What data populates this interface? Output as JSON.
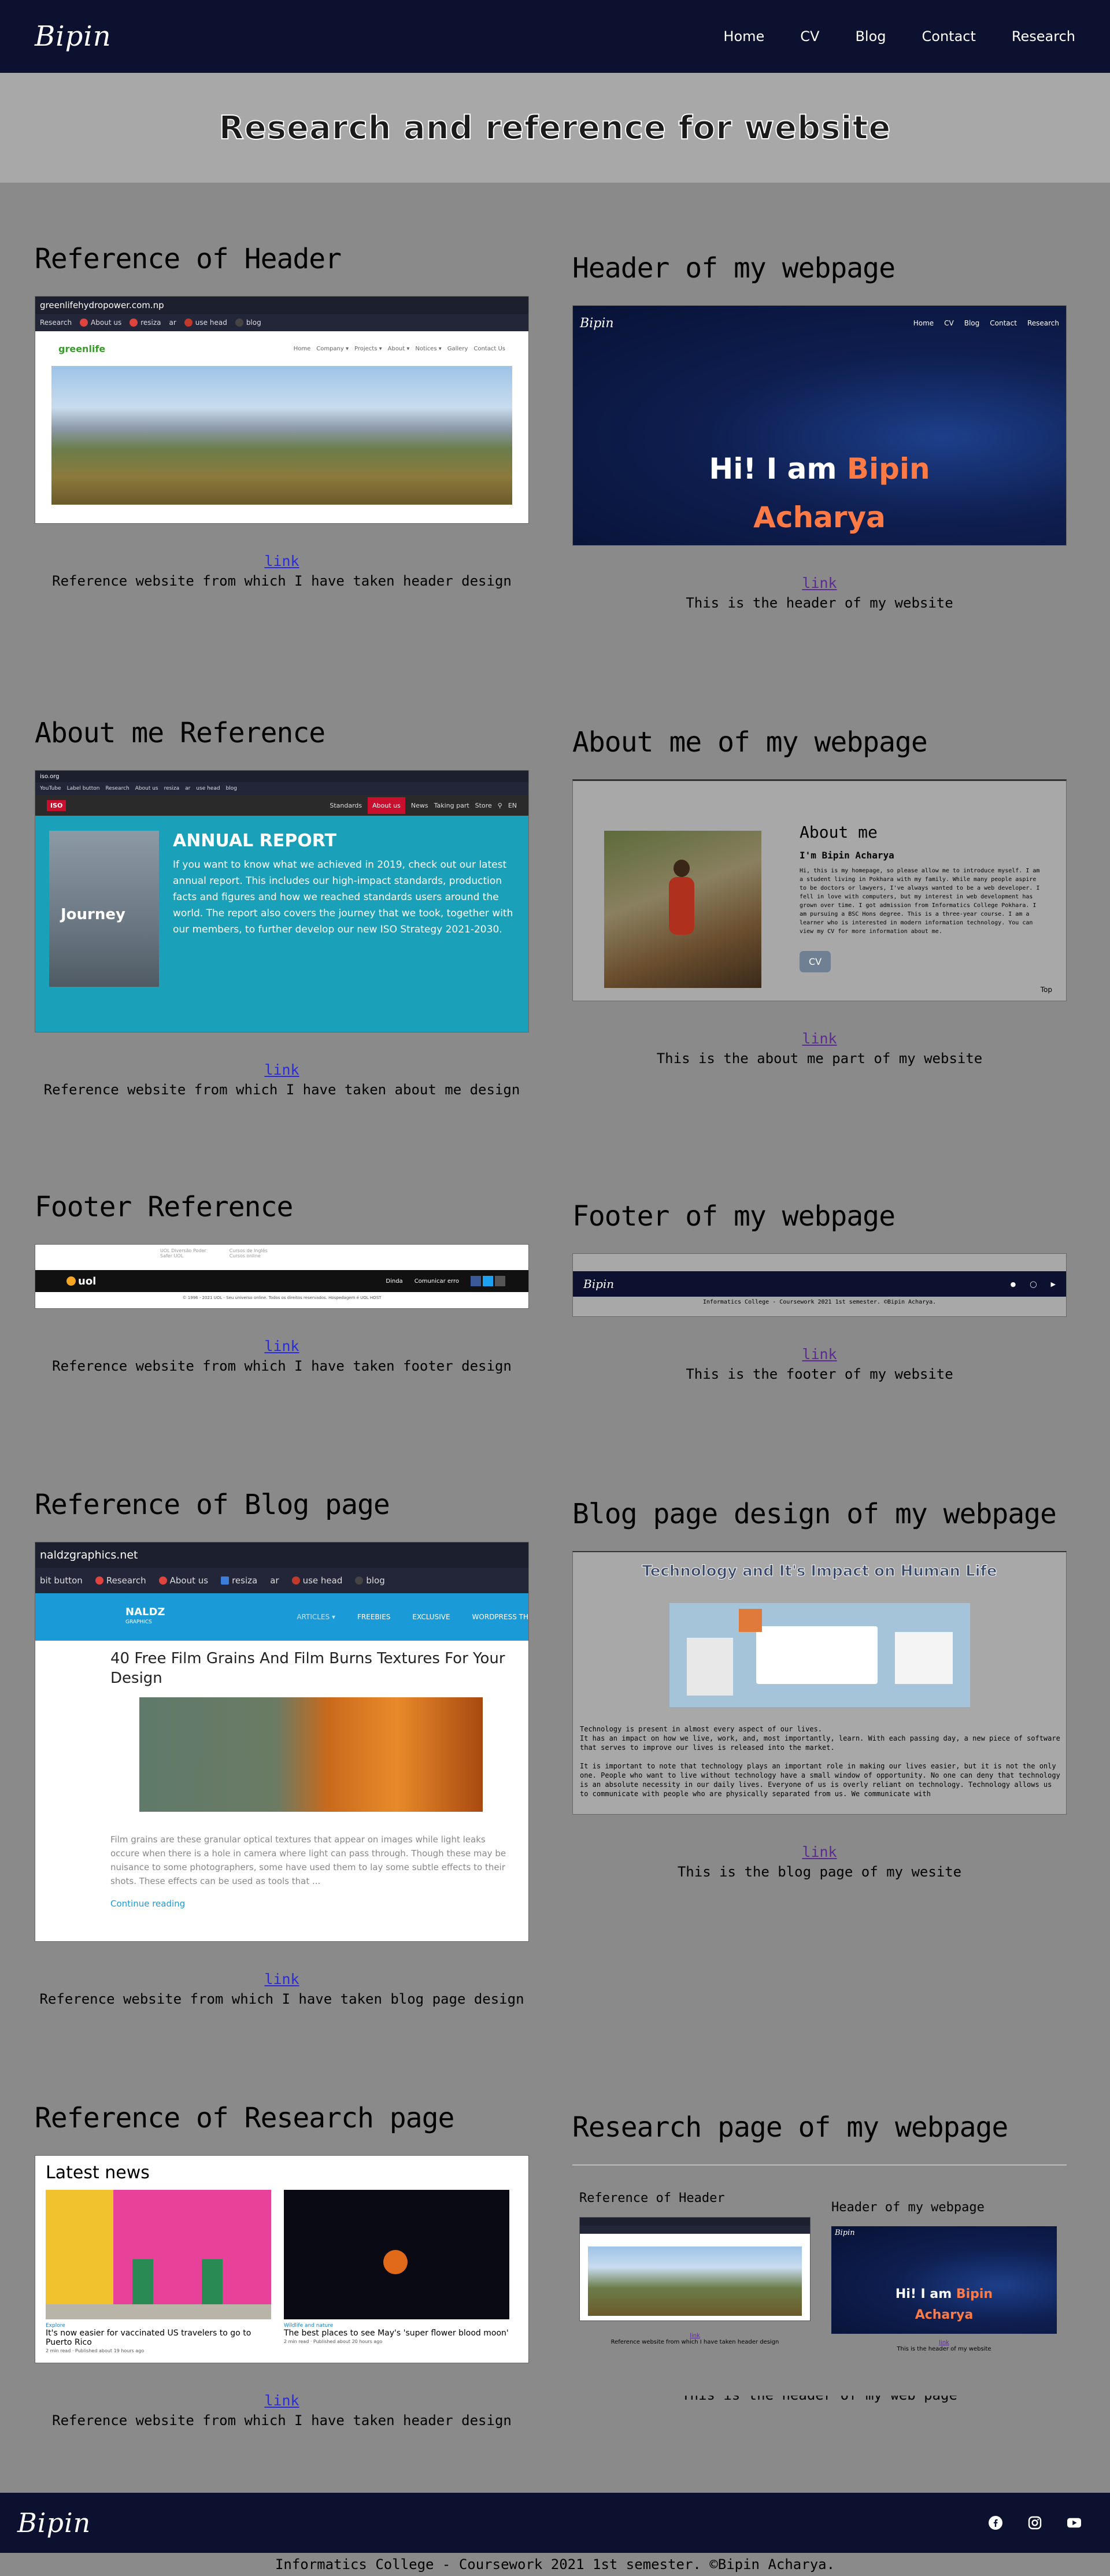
{
  "nav": {
    "logo": "Bipin",
    "links": [
      "Home",
      "CV",
      "Blog",
      "Contact",
      "Research"
    ]
  },
  "hero": {
    "title": "Research and reference for website"
  },
  "sections": {
    "ref_header": {
      "title": "Reference of Header",
      "link": "link",
      "caption": "Reference website from which I have taken header design",
      "shot": {
        "url": "greenlifehydropower.com.np",
        "bookmarks": [
          "Research",
          "About us",
          "resiza",
          "ar",
          "use head",
          "blog"
        ],
        "site_nav": [
          "Home",
          "Company ▾",
          "Projects ▾",
          "About ▾",
          "Notices ▾",
          "Gallery",
          "Contact Us"
        ],
        "logo_text": "greenlife"
      }
    },
    "my_header": {
      "title": "Header of my webpage",
      "link": "link",
      "caption": "This is the header of my website",
      "shot": {
        "logo": "Bipin",
        "nav": [
          "Home",
          "CV",
          "Blog",
          "Contact",
          "Research"
        ],
        "greeting": "Hi! I am",
        "name_first": "Bipin",
        "name_last": "Acharya"
      }
    },
    "ref_about": {
      "title": "About me Reference",
      "link": "link",
      "caption": "Reference website from which I have taken about me design",
      "shot": {
        "url": "iso.org",
        "bookmarks": [
          "YouTube",
          "Label button",
          "Research",
          "About us",
          "resiza",
          "ar",
          "use head",
          "blog"
        ],
        "site_nav": [
          "Standards",
          "About us",
          "News",
          "Taking part",
          "Store"
        ],
        "lang": "EN",
        "heading": "ANNUAL REPORT",
        "body": "If you want to know what we achieved in 2019, check out our latest annual report. This includes our high-impact standards, production facts and figures and how we reached standards users around the world. The report also covers the journey that we took, together with our members, to further develop our new ISO Strategy 2021-2030.",
        "cover_text": "Journey",
        "iso_badge": "ISO"
      }
    },
    "my_about": {
      "title": "About me of my webpage",
      "link": "link",
      "caption": "This is the about me part of my website",
      "shot": {
        "heading": "About me",
        "subheading": "I'm Bipin Acharya",
        "body": "Hi, this is my homepage, so please allow me to introduce myself. I am a student living in Pokhara with my family. While many people aspire to be doctors or lawyers, I've always wanted to be a web developer. I fell in love with computers, but my interest in web development has grown over time. I got admission from Informatics College Pokhara. I am pursuing a BSC Hons degree. This is a three-year course. I am a learner who is interested in modern information technology. You can view my CV for more information about me.",
        "button": "CV",
        "top": "Top"
      }
    },
    "ref_footer": {
      "title": "Footer Reference",
      "link": "link",
      "caption": "Reference website from which I have taken footer design",
      "shot": {
        "links_col1": [
          "UOL Diversão Poder",
          "Safer UOL"
        ],
        "links_col2": [
          "Cursos de Inglês",
          "Cursos online"
        ],
        "brand": "uol",
        "right_links": [
          "Dinda",
          "Comunicar erro"
        ],
        "bottom": "© 1996 - 2021 UOL - Seu universo online. Todos os direitos reservados. Hospedagem é UOL HOST"
      }
    },
    "my_footer": {
      "title": "Footer of my webpage",
      "link": "link",
      "caption": "This is the footer of my website",
      "shot": {
        "logo": "Bipin",
        "copyright": "Informatics College - Coursework 2021 1st semester. ©Bipin Acharya."
      }
    },
    "ref_blog": {
      "title": "Reference of Blog page",
      "link": "link",
      "caption": "Reference website from which I have taken blog page design",
      "shot": {
        "url": "naldzgraphics.net",
        "bookmarks": [
          "bit button",
          "Research",
          "About us",
          "resiza",
          "ar",
          "use head",
          "blog"
        ],
        "brand": "NALDZ",
        "brand_sub": "GRAPHICS",
        "site_nav": [
          "ARTICLES ▾",
          "FREEBIES",
          "EXCLUSIVE",
          "WORDPRESS TH"
        ],
        "post_title": "40 Free Film Grains And Film Burns Textures For Your Design",
        "post_excerpt": "Film grains are these granular optical textures that appear on images while light leaks occure when there is a hole in camera where light can pass through. Though these may be nuisance to some photographers, some have used them to lay some subtle effects to their shots. These effects can be used as tools that ...",
        "continue": "Continue reading"
      }
    },
    "my_blog": {
      "title": "Blog page design of my webpage",
      "link": "link",
      "caption": "This is the blog page of my wesite",
      "shot": {
        "heading": "Technology and It's Impact on Human Life",
        "para1": "Technology is present in almost every aspect of our lives.",
        "para2": "It has an impact on how we live, work, and, most importantly, learn. With each passing day, a new piece of software that serves to improve our lives is released into the market.",
        "para3": "It is important to note that technology plays an important role in making our lives easier, but it is not the only one. People who want to live without technology have a small window of opportunity. No one can deny that technology is an absolute necessity in our daily lives. Everyone of us is overly reliant on technology. Technology allows us to communicate with people who are physically separated from us. We communicate with"
      }
    },
    "ref_research": {
      "title": "Reference of Research page",
      "link": "link",
      "caption": "Reference website from which I have taken header design",
      "shot": {
        "heading": "Latest news",
        "cards": [
          {
            "tag": "Explore",
            "title": "It's now easier for vaccinated US travelers to go to Puerto Rico",
            "meta": "2 min read · Published about 19 hours ago"
          },
          {
            "tag": "Wildlife and nature",
            "title": "The best places to see May's 'super flower blood moon'",
            "meta": "2 min read · Published about 20 hours ago"
          }
        ]
      }
    },
    "my_research": {
      "title": "Research page of my webpage",
      "link": "link",
      "caption": "This is the header of my web page",
      "shot": {
        "left_title": "Reference of Header",
        "right_title": "Header of my webpage",
        "left_link": "link",
        "left_caption": "Reference website from which I have taken header design",
        "right_link": "link",
        "right_caption": "This is the header of my website",
        "greeting": "Hi! I am",
        "name_first": "Bipin",
        "name_last": "Acharya",
        "logo": "Bipin"
      }
    }
  },
  "footer": {
    "logo": "Bipin",
    "icons": [
      "facebook-icon",
      "instagram-icon",
      "youtube-icon"
    ],
    "copyright": "Informatics College - Coursework 2021 1st semester. ©Bipin Acharya."
  },
  "colors": {
    "navy": "#0c1130",
    "page_bg": "#8a8a8a",
    "hero_bg": "#a8a8a8",
    "accent_orange": "#ff7a45",
    "iso_teal": "#1aa0b8",
    "naldz_blue": "#1a9bd7"
  }
}
